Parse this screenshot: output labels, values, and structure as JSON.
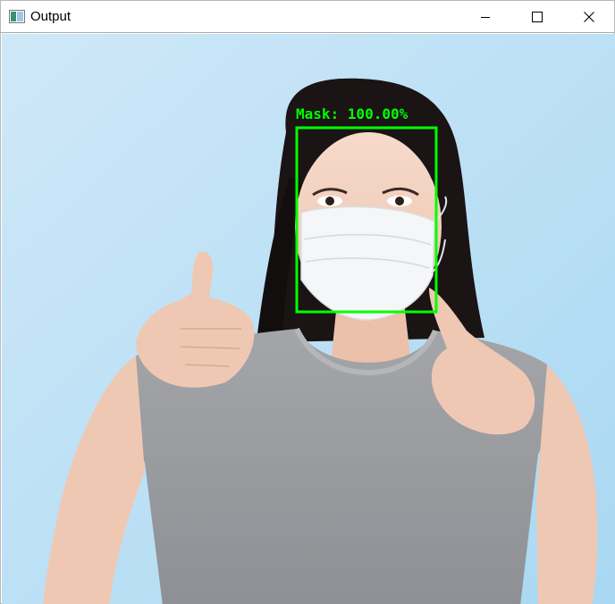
{
  "window": {
    "title": "Output",
    "app_icon": "opencv-window-icon",
    "controls": {
      "minimize_icon": "minimize-icon",
      "maximize_icon": "maximize-icon",
      "close_icon": "close-icon"
    }
  },
  "image": {
    "subject": "person with face mask",
    "colors": {
      "background": "#bfe3f7",
      "box": "#00ff00"
    }
  },
  "detection": {
    "label": "Mask: 100.00%"
  }
}
